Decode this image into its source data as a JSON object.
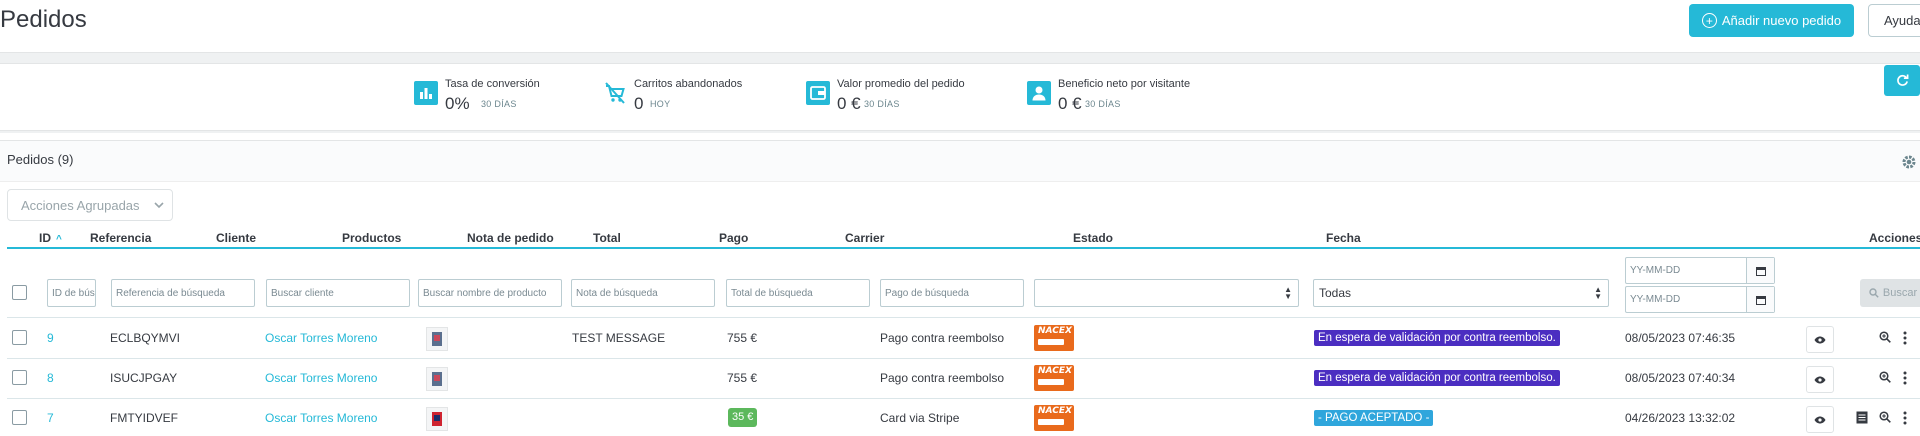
{
  "header": {
    "title": "Pedidos",
    "add_button_label": "Añadir nuevo pedido",
    "help_button_label": "Ayuda"
  },
  "kpis": [
    {
      "label": "Tasa de conversión",
      "value": "0%",
      "sub": "30 DÍAS",
      "icon": "bar-chart-icon"
    },
    {
      "label": "Carritos abandonados",
      "value": "0",
      "sub": "HOY",
      "icon": "cart-off-icon"
    },
    {
      "label": "Valor promedio del pedido",
      "value": "0 €",
      "sub": "30 DÍAS",
      "icon": "wallet-icon"
    },
    {
      "label": "Beneficio neto por visitante",
      "value": "0 €",
      "sub": "30 DÍAS",
      "icon": "user-icon"
    }
  ],
  "grid": {
    "title": "Pedidos (9)",
    "bulk_actions_label": "Acciones Agrupadas",
    "columns": [
      "ID",
      "Referencia",
      "Cliente",
      "Productos",
      "Nota de pedido",
      "Total",
      "Pago",
      "Carrier",
      "Estado",
      "Fecha",
      "Acciones"
    ],
    "filters": {
      "id_placeholder": "ID de búsq",
      "reference_placeholder": "Referencia de búsqueda",
      "customer_placeholder": "Buscar cliente",
      "products_placeholder": "Buscar nombre de producto",
      "note_placeholder": "Nota de búsqueda",
      "total_placeholder": "Total de búsqueda",
      "payment_placeholder": "Pago de búsqueda",
      "carrier_value": "",
      "status_value": "Todas",
      "date_from_placeholder": "YY-MM-DD",
      "date_to_placeholder": "YY-MM-DD",
      "search_button_label": "Buscar"
    },
    "rows": [
      {
        "id": "9",
        "reference": "ECLBQYMVI",
        "customer": "Oscar Torres Moreno",
        "note": "TEST MESSAGE",
        "total": "755 €",
        "total_highlight": false,
        "payment": "Pago contra reembolso",
        "carrier": "NACEX",
        "status": "En espera de validación por contra reembolso.",
        "status_color": "#4b2ec1",
        "date": "08/05/2023 07:46:35",
        "has_invoice": false
      },
      {
        "id": "8",
        "reference": "ISUCJPGAY",
        "customer": "Oscar Torres Moreno",
        "note": "",
        "total": "755 €",
        "total_highlight": false,
        "payment": "Pago contra reembolso",
        "carrier": "NACEX",
        "status": "En espera de validación por contra reembolso.",
        "status_color": "#4b2ec1",
        "date": "08/05/2023 07:40:34",
        "has_invoice": false
      },
      {
        "id": "7",
        "reference": "FMTYIDVEF",
        "customer": "Oscar Torres Moreno",
        "note": "",
        "total": "35 €",
        "total_highlight": true,
        "payment": "Card via Stripe",
        "carrier": "NACEX",
        "status": "- PAGO ACEPTADO -",
        "status_color": "#2fa6dc",
        "date": "04/26/2023 13:32:02",
        "has_invoice": true
      }
    ]
  }
}
